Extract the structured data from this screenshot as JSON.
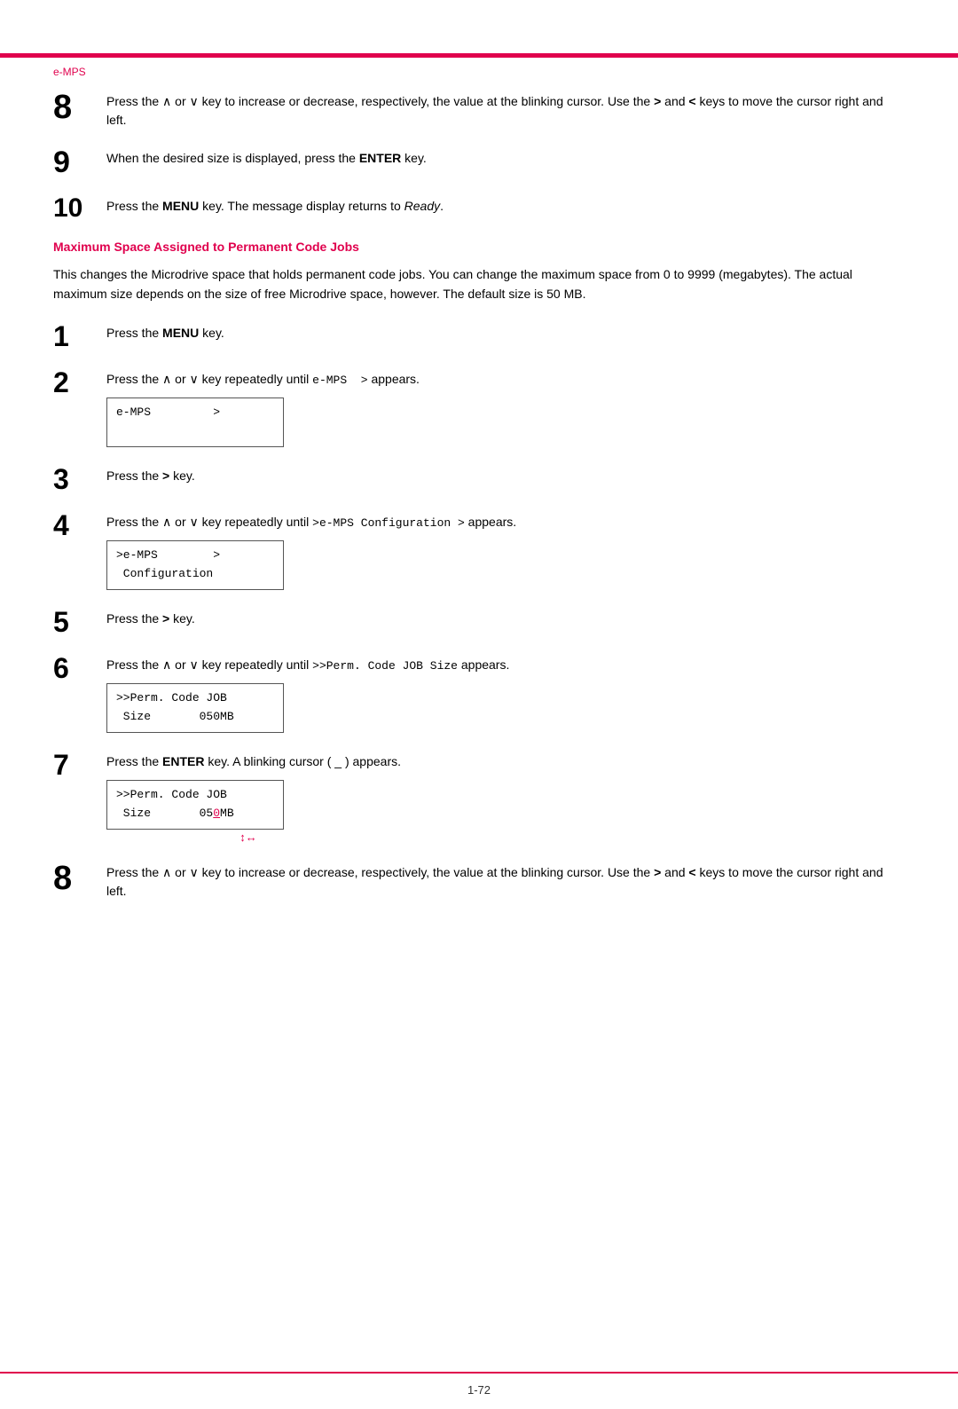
{
  "header": {
    "label": "e-MPS"
  },
  "footer": {
    "page_number": "1-72"
  },
  "steps_top": [
    {
      "num": "8",
      "num_size": "large",
      "text": "Press the ∧ or ∨ key to increase or decrease, respectively, the value at the blinking cursor. Use the > and < keys to move the cursor right and left."
    },
    {
      "num": "9",
      "text": "When the desired size is displayed, press the ENTER key.",
      "bold_parts": [
        "ENTER"
      ]
    },
    {
      "num": "10",
      "text": "Press the MENU key. The message display returns to Ready.",
      "bold_parts": [
        "MENU"
      ],
      "italic_parts": [
        "Ready"
      ]
    }
  ],
  "section_heading": "Maximum Space Assigned to Permanent Code Jobs",
  "body_text": "This changes the Microdrive space that holds permanent code jobs. You can change the maximum space from 0 to 9999 (megabytes). The actual maximum size depends on the size of free Microdrive space, however. The default size is 50 MB.",
  "steps_main": [
    {
      "num": "1",
      "text": "Press the MENU key.",
      "bold_parts": [
        "MENU"
      ]
    },
    {
      "num": "2",
      "text": "Press the ∧ or ∨ key repeatedly until e-MPS  > appears.",
      "mono_parts": [
        "e-MPS  >"
      ],
      "display": {
        "line1": "e-MPS         >",
        "line2": ""
      }
    },
    {
      "num": "3",
      "text": "Press the > key."
    },
    {
      "num": "4",
      "text": "Press the ∧ or ∨ key repeatedly until >e-MPS Configuration > appears.",
      "mono_parts": [
        ">e-MPS Configuration >"
      ],
      "display": {
        "line1": ">e-MPS        >",
        "line2": " Configuration"
      }
    },
    {
      "num": "5",
      "text": "Press the > key."
    },
    {
      "num": "6",
      "text": "Press the ∧ or ∨ key repeatedly until >>Perm. Code JOB Size appears.",
      "mono_parts": [
        ">>Perm. Code JOB Size"
      ],
      "display": {
        "line1": ">>Perm. Code JOB",
        "line2": " Size       050MB"
      }
    },
    {
      "num": "7",
      "text": "Press the ENTER key. A blinking cursor ( _ ) appears.",
      "bold_parts": [
        "ENTER"
      ],
      "display": {
        "line1": ">>Perm. Code JOB",
        "line2": " Size       050MB",
        "cursor": true
      }
    },
    {
      "num": "8",
      "num_size": "large",
      "text": "Press the ∧ or ∨ key to increase or decrease, respectively, the value at the blinking cursor. Use the > and < keys to move the cursor right and left."
    }
  ]
}
